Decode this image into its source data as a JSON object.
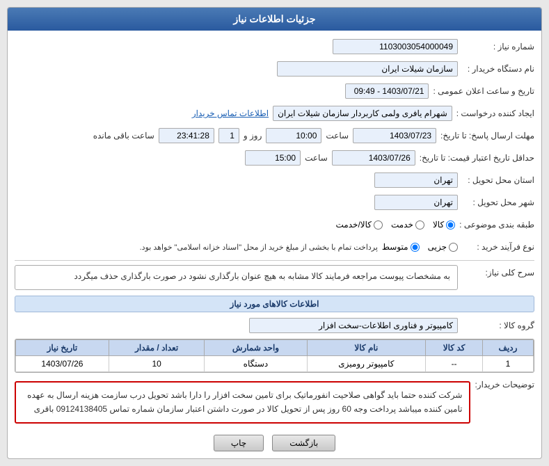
{
  "header": {
    "title": "جزئیات اطلاعات نیاز"
  },
  "fields": {
    "shomareNiaz_label": "شماره نیاز :",
    "shomareNiaz_value": "1103003054000049",
    "namDastgah_label": "نام دستگاه خریدار :",
    "namDastgah_value": "سازمان شیلات ایران",
    "tarikhoSaat_label": "تاریخ و ساعت اعلان عمومی :",
    "tarikhoSaat_value": "1403/07/21 - 09:49",
    "ijadKonande_label": "ایجاد کننده درخواست :",
    "ijadKonande_value": "شهرام یافری ولمی کاربردار سازمان شیلات ایران",
    "ettelaatTamas_label": "اطلاعات تماس خریدار",
    "mohlat_label": "مهلت ارسال پاسخ: تا تاریخ:",
    "mohlat_date": "1403/07/23",
    "mohlat_saat_label": "ساعت",
    "mohlat_saat_value": "10:00",
    "mohlat_rooz_label": "روز و",
    "mohlat_rooz_value": "1",
    "mohlat_baqi_label": "ساعت باقی مانده",
    "mohlat_baqi_value": "23:41:28",
    "hadaqal_label": "حداقل تاریخ اعتبار قیمت: تا تاریخ:",
    "hadaqal_date": "1403/07/26",
    "hadaqal_saat_label": "ساعت",
    "hadaqal_saat_value": "15:00",
    "ostan_label": "استان محل تحویل :",
    "ostan_value": "تهران",
    "shahr_label": "شهر محل تحویل :",
    "shahr_value": "تهران",
    "tabaqe_label": "طبقه بندی موضوعی :",
    "tabaqe_kala": "کالا",
    "tabaqe_khadamat": "خدمت",
    "tabaqe_kala_khadamat": "کالا/خدمت",
    "noeFarayand_label": "نوع فرآیند خرید :",
    "noeFarayand_jozi": "جزیی",
    "noeFarayand_motevaset": "متوسط",
    "noeFarayand_text": "پرداخت تمام با بخشی از مبلغ خرید از محل \"اسناد خزانه اسلامی\" خواهد بود.",
    "sarkolliNiaz_label": "سرح کلی نیاز:",
    "sarkolliNiaz_value": "به مشخصات پیوست مراجعه فرمایند کالا مشابه به هیچ عنوان بارگذاری نشود در صورت بارگذاری حذف میگردد",
    "ettelaatSection_title": "اطلاعات کالاهای مورد نیاز",
    "groupeKala_label": "گروه کالا :",
    "groupeKala_value": "کامپیوتر و فناوری اطلاعات-سخت افزار",
    "table": {
      "headers": [
        "ردیف",
        "کد کالا",
        "نام کالا",
        "واحد شمارش",
        "تعداد / مقدار",
        "تاریخ نیاز"
      ],
      "rows": [
        {
          "radif": "1",
          "kodKala": "--",
          "namKala": "کامپیوتر رومیزی",
          "vahed": "دستگاه",
          "tedad": "10",
          "tarikh": "1403/07/26"
        }
      ]
    },
    "tozi_label": "توضیحات خریدار:",
    "tozi_value": "شرکت کننده حتما باید گواهی صلاحیت انفورماتیک برای تامین سخت افزار را دارا باشد تحویل درب سازمت هزینه ارسال به عهده تامین کننده میباشد پرداخت وجه 60 روز پس از تحویل کالا در صورت داشتن اعتبار سازمان شماره تماس 09124138405 باقری"
  },
  "buttons": {
    "back": "بازگشت",
    "print": "چاپ"
  }
}
